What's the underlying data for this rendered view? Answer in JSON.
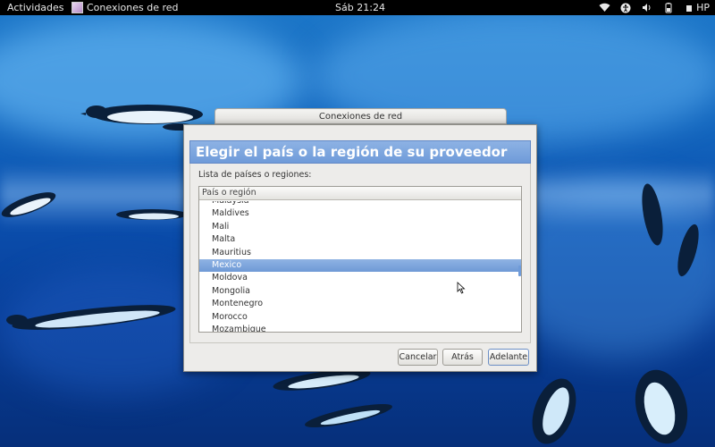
{
  "topbar": {
    "activities_label": "Actividades",
    "app_name": "Conexiones de red",
    "clock": "Sáb 21:24",
    "user_name": "HP",
    "icons": [
      "network-wireless-icon",
      "accessibility-icon",
      "volume-icon",
      "battery-icon"
    ]
  },
  "parent_window": {
    "title": "Conexiones de red"
  },
  "dialog": {
    "heading": "Elegir el país o la región de su proveedor",
    "list_label": "Lista de países o regiones:",
    "column_header": "País o región",
    "items": [
      "Malaysia",
      "Maldives",
      "Mali",
      "Malta",
      "Mauritius",
      "Mexico",
      "Moldova",
      "Mongolia",
      "Montenegro",
      "Morocco",
      "Mozambique"
    ],
    "selected_item": "Mexico",
    "buttons": {
      "cancel": "Cancelar",
      "back": "Atrás",
      "next": "Adelante"
    },
    "accent_color": "#6f9bd9"
  },
  "wallpaper": {
    "theme": "underwater penguins",
    "base_color": "#0b4fae"
  }
}
